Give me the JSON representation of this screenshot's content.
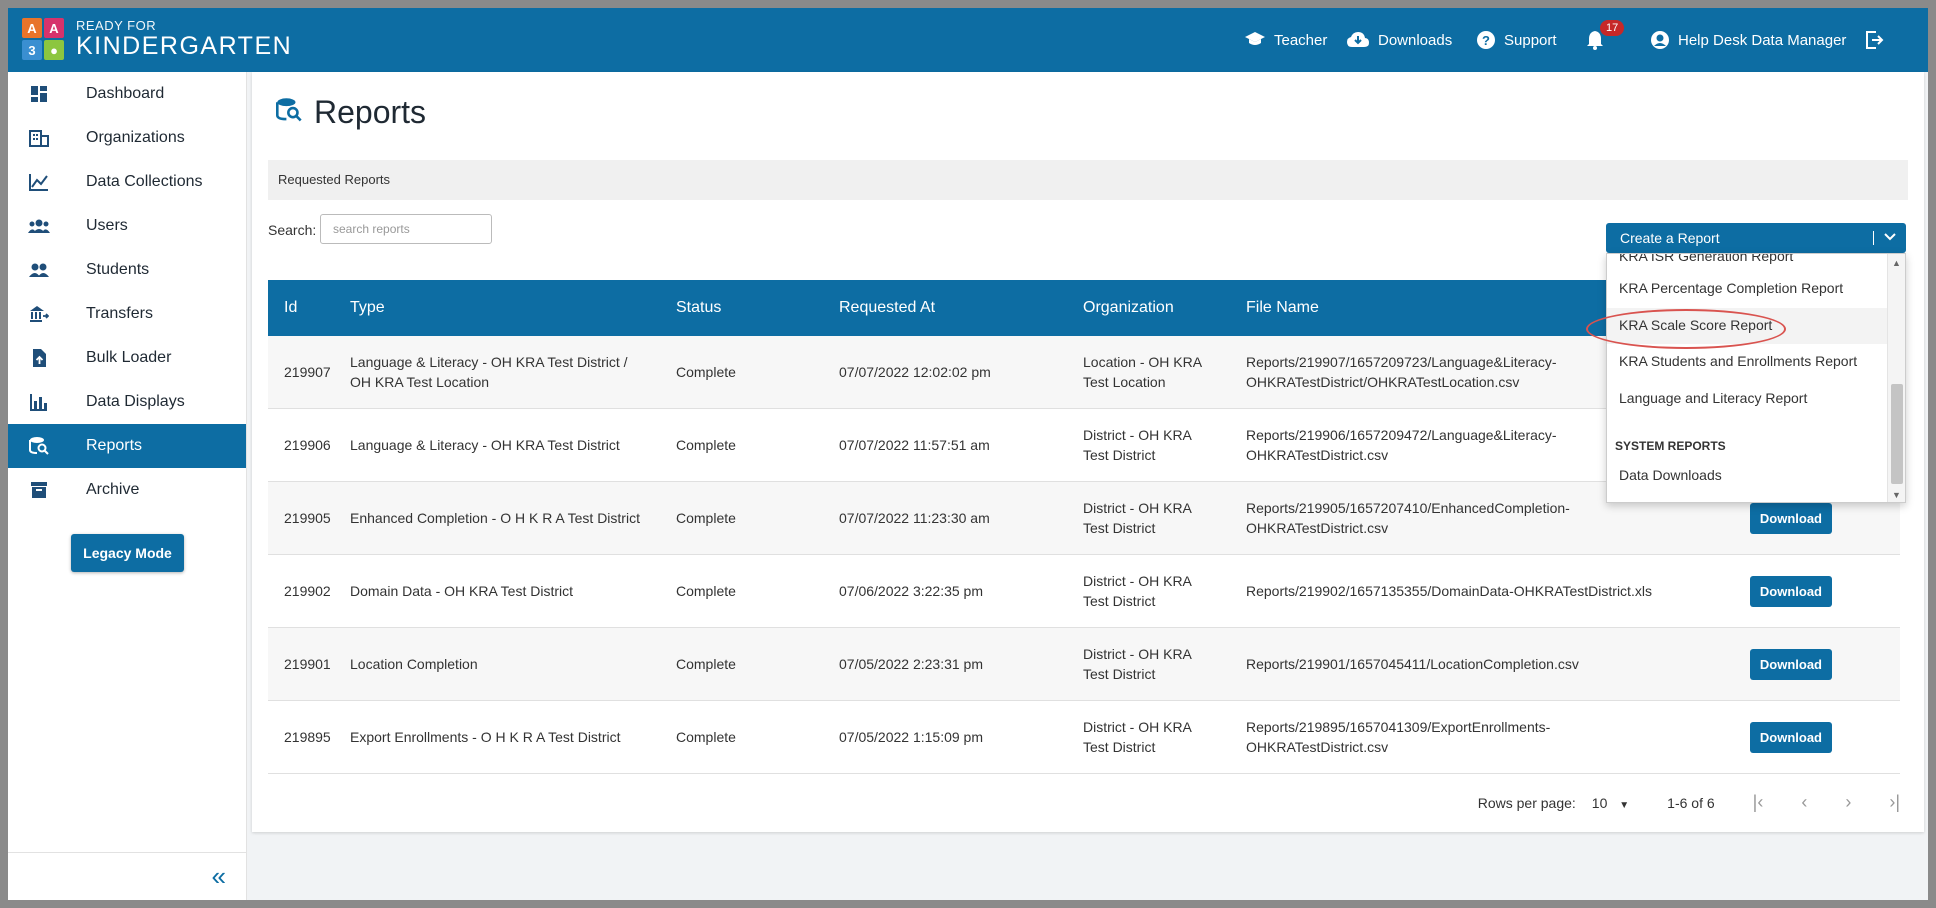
{
  "app": {
    "logo_small": "READY FOR",
    "logo_large": "KINDERGARTEN",
    "logo_blocks": [
      "A",
      "A",
      "3",
      "●"
    ]
  },
  "header": {
    "teacher": "Teacher",
    "downloads": "Downloads",
    "support": "Support",
    "notifications_count": "17",
    "user": "Help Desk Data Manager"
  },
  "sidebar": {
    "items": [
      {
        "label": "Dashboard",
        "icon": "dashboard-icon"
      },
      {
        "label": "Organizations",
        "icon": "building-icon"
      },
      {
        "label": "Data Collections",
        "icon": "chart-line-icon"
      },
      {
        "label": "Users",
        "icon": "users-icon"
      },
      {
        "label": "Students",
        "icon": "students-icon"
      },
      {
        "label": "Transfers",
        "icon": "transfer-icon"
      },
      {
        "label": "Bulk Loader",
        "icon": "upload-icon"
      },
      {
        "label": "Data Displays",
        "icon": "bar-chart-icon"
      },
      {
        "label": "Reports",
        "icon": "report-search-icon",
        "active": true
      },
      {
        "label": "Archive",
        "icon": "archive-icon"
      }
    ],
    "legacy_button": "Legacy Mode",
    "collapse": "«"
  },
  "page": {
    "title": "Reports",
    "breadcrumb": "Requested Reports",
    "search_label": "Search:",
    "search_placeholder": "search reports"
  },
  "table": {
    "headers": [
      "Id",
      "Type",
      "Status",
      "Requested At",
      "Organization",
      "File Name"
    ],
    "rows": [
      {
        "id": "219907",
        "type_1": "Language & Literacy - OH KRA Test District /",
        "type_2": "OH KRA Test Location",
        "status": "Complete",
        "requested": "07/07/2022 12:02:02 pm",
        "org_1": "Location - OH KRA",
        "org_2": "Test Location",
        "file_1": "Reports/219907/1657209723/Language&Literacy-",
        "file_2": "OHKRATestDistrict/OHKRATestLocation.csv",
        "action": ""
      },
      {
        "id": "219906",
        "type_1": "Language & Literacy - OH KRA Test District",
        "type_2": "",
        "status": "Complete",
        "requested": "07/07/2022 11:57:51 am",
        "org_1": "District - OH KRA",
        "org_2": "Test District",
        "file_1": "Reports/219906/1657209472/Language&Literacy-",
        "file_2": "OHKRATestDistrict.csv",
        "action": ""
      },
      {
        "id": "219905",
        "type_1": "Enhanced Completion - O H K R A Test District",
        "type_2": "",
        "status": "Complete",
        "requested": "07/07/2022 11:23:30 am",
        "org_1": "District - OH KRA",
        "org_2": "Test District",
        "file_1": "Reports/219905/1657207410/EnhancedCompletion-",
        "file_2": "OHKRATestDistrict.csv",
        "action": "Download"
      },
      {
        "id": "219902",
        "type_1": "Domain Data - OH KRA Test District",
        "type_2": "",
        "status": "Complete",
        "requested": "07/06/2022 3:22:35 pm",
        "org_1": "District - OH KRA",
        "org_2": "Test District",
        "file_1": "Reports/219902/1657135355/DomainData-OHKRATestDistrict.xls",
        "file_2": "",
        "action": "Download"
      },
      {
        "id": "219901",
        "type_1": "Location Completion",
        "type_2": "",
        "status": "Complete",
        "requested": "07/05/2022 2:23:31 pm",
        "org_1": "District - OH KRA",
        "org_2": "Test District",
        "file_1": "Reports/219901/1657045411/LocationCompletion.csv",
        "file_2": "",
        "action": "Download"
      },
      {
        "id": "219895",
        "type_1": "Export Enrollments - O H K R A Test District",
        "type_2": "",
        "status": "Complete",
        "requested": "07/05/2022 1:15:09 pm",
        "org_1": "District - OH KRA",
        "org_2": "Test District",
        "file_1": "Reports/219895/1657041309/ExportEnrollments-",
        "file_2": "OHKRATestDistrict.csv",
        "action": "Download"
      }
    ]
  },
  "pagination": {
    "rows_label": "Rows per page:",
    "rows_value": "10",
    "range": "1-6 of 6"
  },
  "dropdown": {
    "button": "Create a Report",
    "items": [
      "KRA ISR Generation Report",
      "KRA Percentage Completion Report",
      "KRA Scale Score Report",
      "KRA Students and Enrollments Report",
      "Language and Literacy Report"
    ],
    "section_header": "SYSTEM REPORTS",
    "system_items": [
      "Data Downloads"
    ]
  },
  "colors": {
    "brand": "#0d6da3",
    "highlight_ring": "#d9534f"
  }
}
